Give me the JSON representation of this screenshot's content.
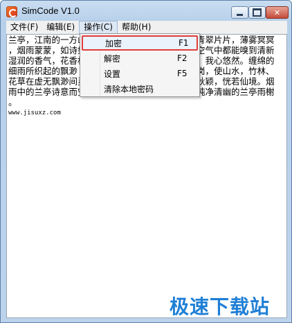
{
  "window": {
    "title": "SimCode V1.0"
  },
  "menubar": {
    "file": "文件(F)",
    "edit": "编辑(E)",
    "operate": "操作(C)",
    "help": "帮助(H)"
  },
  "dropdown": {
    "items": [
      {
        "label": "加密",
        "shortcut": "F1"
      },
      {
        "label": "解密",
        "shortcut": "F2"
      },
      {
        "label": "设置",
        "shortcut": "F5"
      },
      {
        "label": "清除本地密码",
        "shortcut": ""
      }
    ]
  },
  "content": {
    "line1": "兰亭，江南的一方山水",
    "line1_right": "青翠片片，薄雾冥冥",
    "line2": "，烟雨蒙蒙，如诗如",
    "line2_right": "空气中都能嗅到清新",
    "line3": "湿润的香气，花香格",
    "line3_right": "，我心悠然。缠绵的",
    "line4": "细雨所织起的飘渺",
    "line4_right": "岗，使山水，竹林、",
    "line5": "花草在虚无飘渺间灵",
    "line5_right": "秋颖，恍若仙境。烟",
    "line6": "雨中的兰亭诗意而空",
    "line6_right": "纯净清幽的兰亭雨榭",
    "line7": "。",
    "url": "www.jisuxz.com"
  },
  "watermark": "极速下载站"
}
